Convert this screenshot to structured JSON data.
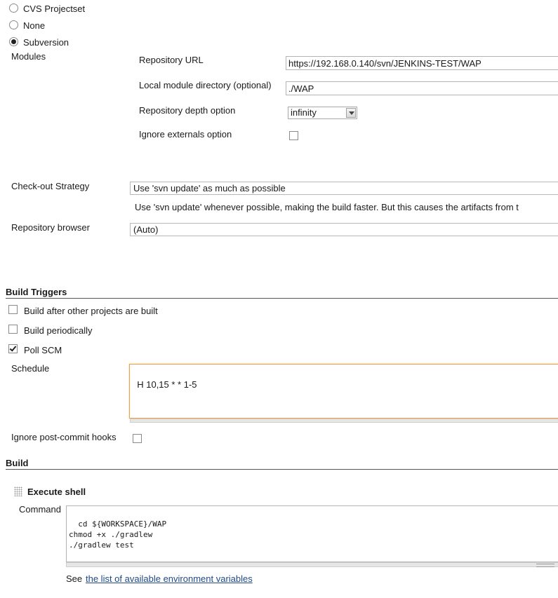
{
  "scm": {
    "options": [
      {
        "label": "CVS Projectset",
        "checked": false
      },
      {
        "label": "None",
        "checked": false
      },
      {
        "label": "Subversion",
        "checked": true
      }
    ]
  },
  "modules": {
    "label": "Modules",
    "repository_url_label": "Repository URL",
    "repository_url_value": "https://192.168.0.140/svn/JENKINS-TEST/WAP",
    "local_dir_label": "Local module directory (optional)",
    "local_dir_value": "./WAP",
    "depth_label": "Repository depth option",
    "depth_value": "infinity",
    "ignore_externals_label": "Ignore externals option",
    "ignore_externals_checked": false
  },
  "checkout": {
    "label": "Check-out Strategy",
    "value": "Use 'svn update' as much as possible",
    "description": "Use 'svn update' whenever possible, making the build faster. But this causes the artifacts from t"
  },
  "repo_browser": {
    "label": "Repository browser",
    "value": "(Auto)"
  },
  "build_triggers": {
    "title": "Build Triggers",
    "options": [
      {
        "label": "Build after other projects are built",
        "checked": false
      },
      {
        "label": "Build periodically",
        "checked": false
      },
      {
        "label": "Poll SCM",
        "checked": true
      }
    ],
    "schedule_label": "Schedule",
    "schedule_value": "H 10,15 * * 1-5",
    "ignore_post_commit_label": "Ignore post-commit hooks",
    "ignore_post_commit_checked": false
  },
  "build": {
    "title": "Build",
    "step_title": "Execute shell",
    "command_label": "Command",
    "command_value": "cd ${WORKSPACE}/WAP\nchmod +x ./gradlew\n./gradlew test",
    "see_text": "See",
    "env_link": "the list of available environment variables"
  },
  "colors": {
    "accent_focus": "#e8a24a",
    "link": "#204a87"
  }
}
